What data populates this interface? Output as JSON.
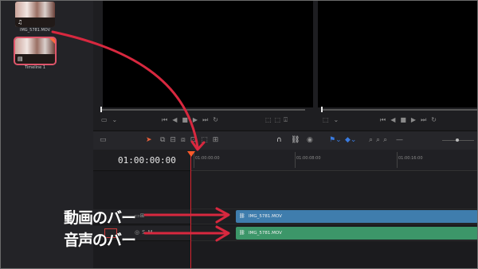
{
  "media_pool": {
    "clips": [
      {
        "label": "IMG_5781.MOV"
      },
      {
        "label": "Timeline 1"
      }
    ]
  },
  "timeline": {
    "timecode": "01:00:00:00",
    "ruler_labels": [
      "01:00:00:00",
      "01:00:08:00",
      "01:00:16:00"
    ],
    "video_clip": {
      "label": "IMG_5781.MOV",
      "color": "#3f7dad"
    },
    "audio_clip": {
      "label": "IMG_5781.MOV",
      "color": "#3c9669"
    }
  },
  "annotations": {
    "video_bar": "動画のバー",
    "audio_bar": "音声のバー",
    "arrow_color": "#d8283f"
  },
  "icons": [
    "music-note-icon",
    "timeline-icon",
    "play-icon",
    "stop-icon",
    "rewind-icon",
    "forward-icon",
    "loop-icon",
    "select-tool-icon",
    "snap-magnet-icon",
    "link-icon",
    "flag-icon",
    "marker-icon",
    "zoom-icon",
    "link-clip-icon"
  ]
}
